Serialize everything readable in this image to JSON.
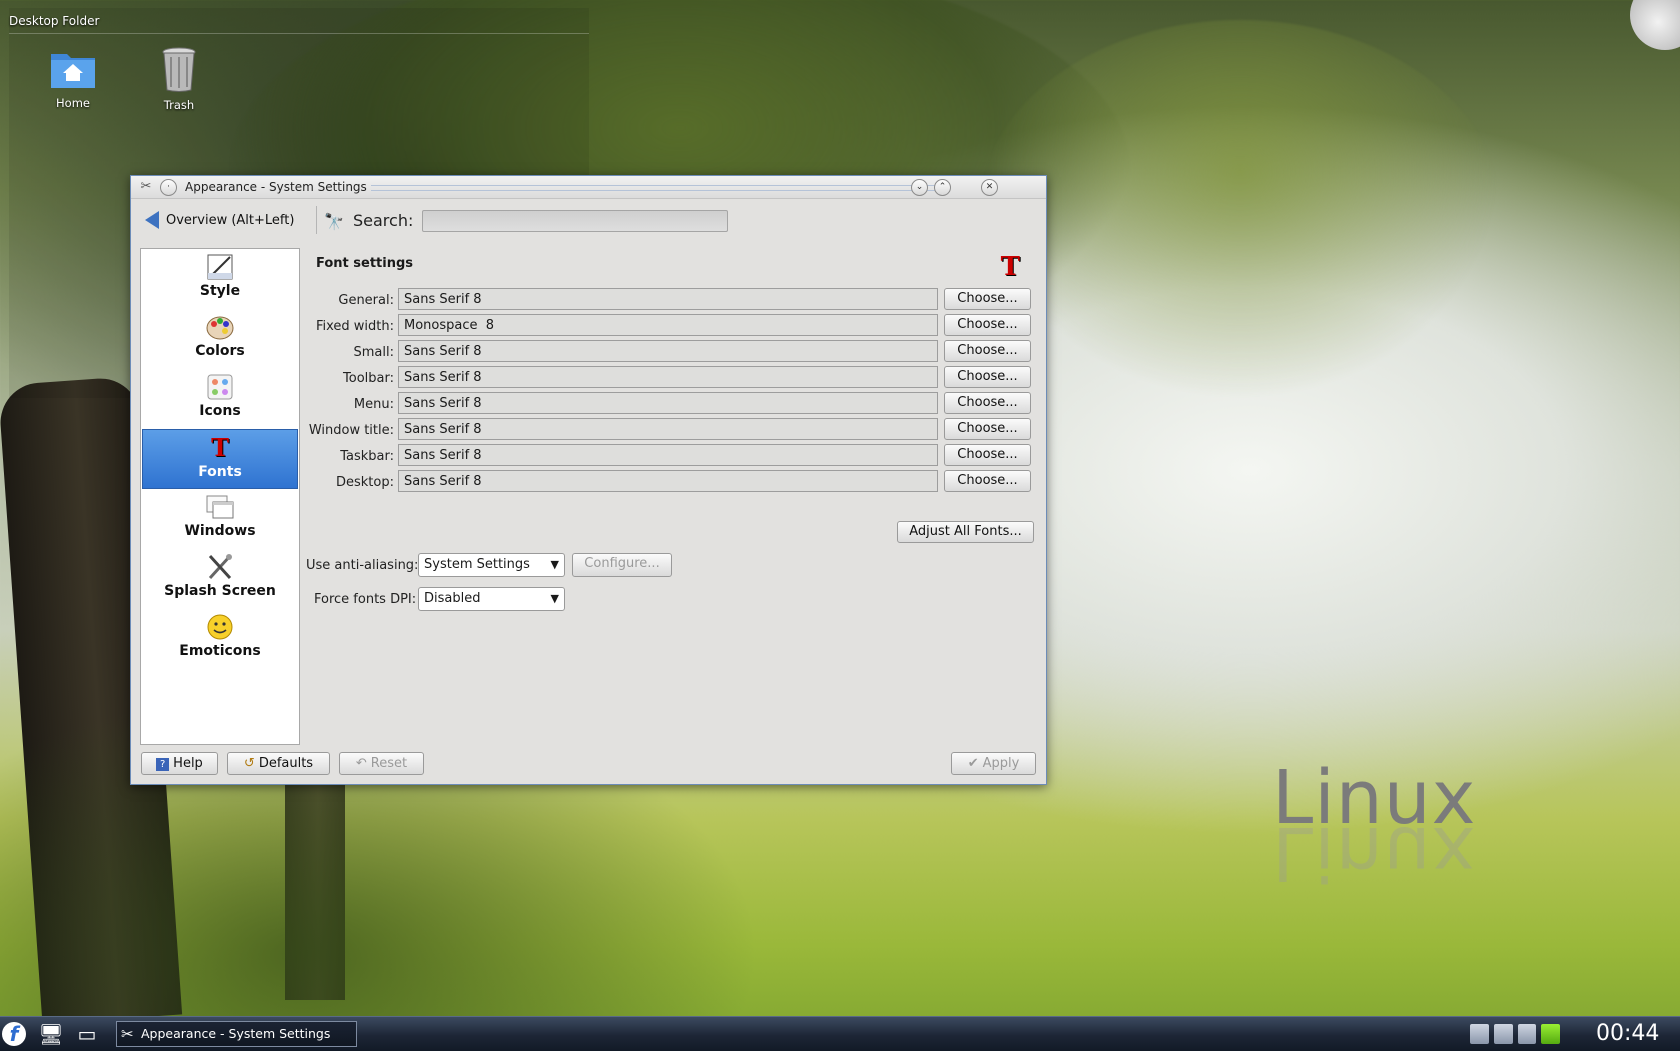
{
  "desktop": {
    "folder_title": "Desktop Folder",
    "icons": [
      {
        "label": "Home",
        "icon": "home-folder-icon"
      },
      {
        "label": "Trash",
        "icon": "trash-icon"
      }
    ],
    "wallpaper_text": "Linux"
  },
  "window": {
    "title": "Appearance - System Settings",
    "toolbar": {
      "overview_label": "Overview (Alt+Left)",
      "search_label": "Search:",
      "search_value": ""
    },
    "sidebar": {
      "items": [
        {
          "label": "Style",
          "icon": "style-icon",
          "active": false
        },
        {
          "label": "Colors",
          "icon": "colors-icon",
          "active": false
        },
        {
          "label": "Icons",
          "icon": "icons-icon",
          "active": false
        },
        {
          "label": "Fonts",
          "icon": "fonts-icon",
          "active": true
        },
        {
          "label": "Windows",
          "icon": "windows-icon",
          "active": false
        },
        {
          "label": "Splash Screen",
          "icon": "splash-screen-icon",
          "active": false
        },
        {
          "label": "Emoticons",
          "icon": "emoticons-icon",
          "active": false
        }
      ]
    },
    "content": {
      "section_title": "Font settings",
      "font_rows": [
        {
          "label": "General:",
          "value": "Sans Serif 8",
          "button": "Choose..."
        },
        {
          "label": "Fixed width:",
          "value": "Monospace  8",
          "button": "Choose..."
        },
        {
          "label": "Small:",
          "value": "Sans Serif 8",
          "button": "Choose..."
        },
        {
          "label": "Toolbar:",
          "value": "Sans Serif 8",
          "button": "Choose..."
        },
        {
          "label": "Menu:",
          "value": "Sans Serif 8",
          "button": "Choose..."
        },
        {
          "label": "Window title:",
          "value": "Sans Serif 8",
          "button": "Choose..."
        },
        {
          "label": "Taskbar:",
          "value": "Sans Serif 8",
          "button": "Choose..."
        },
        {
          "label": "Desktop:",
          "value": "Sans Serif 8",
          "button": "Choose..."
        }
      ],
      "adjust_all_label": "Adjust All Fonts...",
      "anti_aliasing": {
        "label": "Use anti-aliasing:",
        "selected": "System Settings",
        "configure_label": "Configure..."
      },
      "force_dpi": {
        "label": "Force fonts DPI:",
        "selected": "Disabled"
      }
    },
    "footer": {
      "help_label": "Help",
      "defaults_label": "Defaults",
      "reset_label": "Reset",
      "apply_label": "Apply"
    }
  },
  "taskbar": {
    "task_label": "Appearance - System Settings",
    "clock": "00:44"
  },
  "colors": {
    "selection": "#2f73d1",
    "taskbar": "#1d2636"
  }
}
